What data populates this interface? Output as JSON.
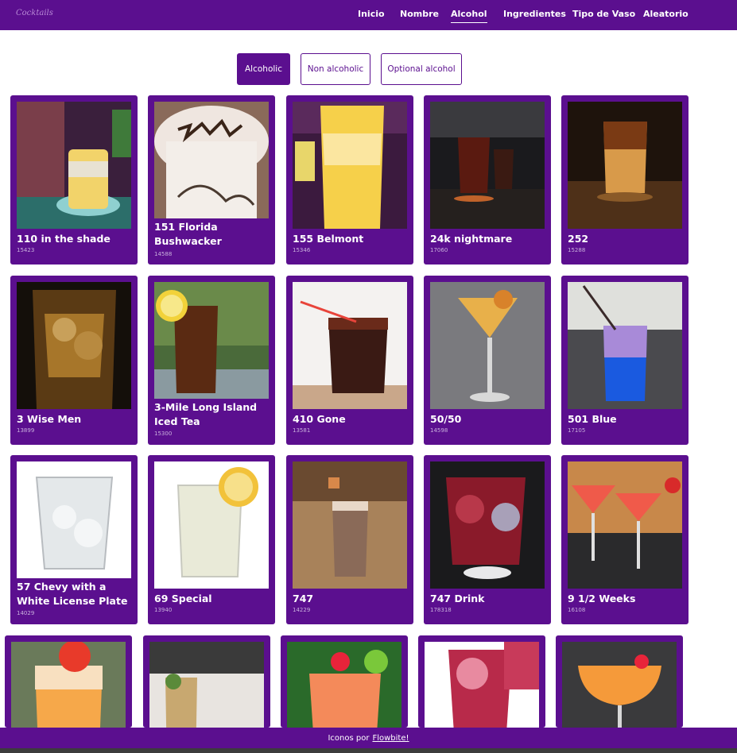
{
  "header": {
    "logo": "Cocktails",
    "nav": [
      {
        "label": "Inicio"
      },
      {
        "label": "Nombre"
      },
      {
        "label": "Alcohol"
      },
      {
        "label": "Ingredientes"
      },
      {
        "label": "Tipo de Vaso"
      },
      {
        "label": "Aleatorio"
      }
    ]
  },
  "filters": [
    {
      "label": "Alcoholic"
    },
    {
      "label": "Non alcoholic"
    },
    {
      "label": "Optional alcohol"
    }
  ],
  "drinks": [
    {
      "name": "110 in the shade",
      "id": "15423"
    },
    {
      "name": "151 Florida Bushwacker",
      "id": "14588"
    },
    {
      "name": "155 Belmont",
      "id": "15346"
    },
    {
      "name": "24k nightmare",
      "id": "17060"
    },
    {
      "name": "252",
      "id": "15288"
    },
    {
      "name": "3 Wise Men",
      "id": "13899"
    },
    {
      "name": "3-Mile Long Island Iced Tea",
      "id": "15300"
    },
    {
      "name": "410 Gone",
      "id": "13581"
    },
    {
      "name": "50/50",
      "id": "14598"
    },
    {
      "name": "501 Blue",
      "id": "17105"
    },
    {
      "name": "57 Chevy with a White License Plate",
      "id": "14029"
    },
    {
      "name": "69 Special",
      "id": "13940"
    },
    {
      "name": "747",
      "id": "14229"
    },
    {
      "name": "747 Drink",
      "id": "178318"
    },
    {
      "name": "9 1/2 Weeks",
      "id": "16108"
    },
    {
      "name": "",
      "id": ""
    },
    {
      "name": "",
      "id": ""
    },
    {
      "name": "",
      "id": ""
    },
    {
      "name": "",
      "id": ""
    },
    {
      "name": "",
      "id": ""
    }
  ],
  "footer": {
    "text": "Iconos por",
    "link": "Flowbite!"
  }
}
